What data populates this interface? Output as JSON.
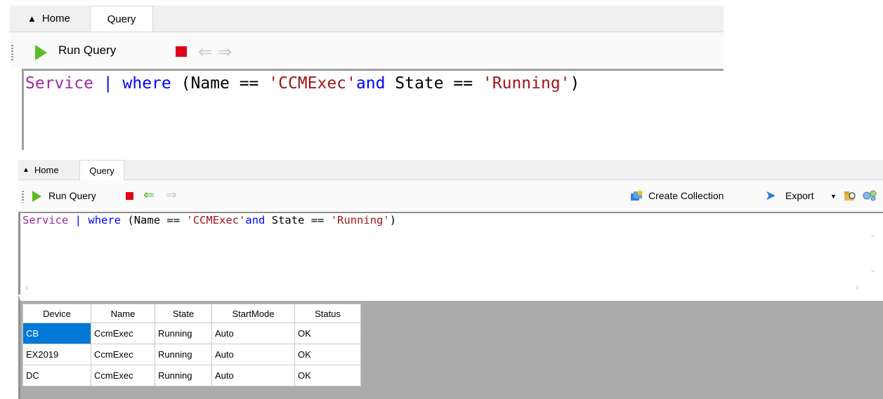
{
  "panel1": {
    "tabs": {
      "home": "Home",
      "query": "Query"
    },
    "toolbar": {
      "run_query": "Run Query"
    },
    "query": {
      "t_service": "Service",
      "t_pipe": "|",
      "t_where": "where",
      "t_open": "(Name == ",
      "t_str1": "'CCMExec'",
      "t_and": "and",
      "t_mid": " State == ",
      "t_str2": "'Running'",
      "t_close": ")"
    }
  },
  "panel2": {
    "tabs": {
      "home": "Home",
      "query": "Query"
    },
    "toolbar": {
      "run_query": "Run Query",
      "create_collection": "Create Collection",
      "export": "Export"
    },
    "query": {
      "t_service": "Service",
      "t_pipe": "|",
      "t_where": "where",
      "t_open": "(Name == ",
      "t_str1": "'CCMExec'",
      "t_and": "and",
      "t_mid": " State == ",
      "t_str2": "'Running'",
      "t_close": ")"
    },
    "results": {
      "columns": [
        "Device",
        "Name",
        "State",
        "StartMode",
        "Status"
      ],
      "rows": [
        [
          "CB",
          "CcmExec",
          "Running",
          "Auto",
          "OK"
        ],
        [
          "EX2019",
          "CcmExec",
          "Running",
          "Auto",
          "OK"
        ],
        [
          "DC",
          "CcmExec",
          "Running",
          "Auto",
          "OK"
        ]
      ]
    }
  },
  "colors": {
    "run_green": "#5dbb26",
    "stop_red": "#e00019",
    "selection_blue": "#0078d7"
  }
}
